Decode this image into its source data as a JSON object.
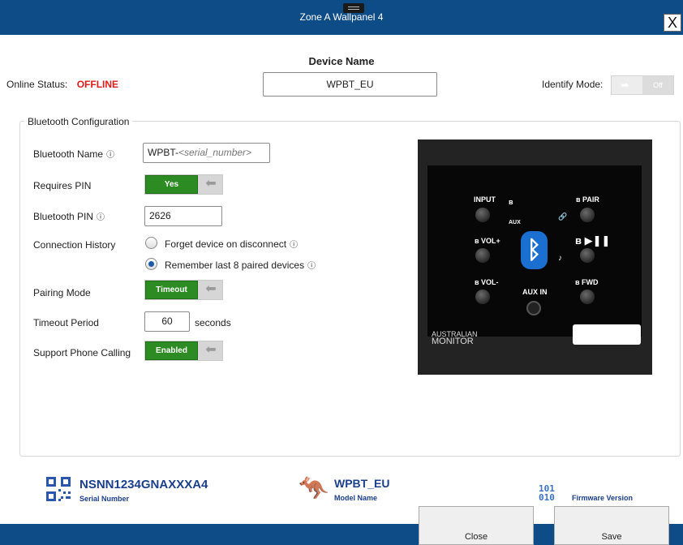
{
  "window": {
    "title": "Zone A Wallpanel 4",
    "close_label": "X"
  },
  "device": {
    "name_label": "Device Name",
    "name_value": "WPBT_EU",
    "online_label": "Online Status:",
    "online_value": "OFFLINE",
    "identify_label": "Identify Mode:",
    "identify_state": "Off"
  },
  "bluetooth": {
    "group_title": "Bluetooth Configuration",
    "name_label": "Bluetooth Name",
    "name_prefix": "WPBT-",
    "name_placeholder": "<serial_number>",
    "requires_pin_label": "Requires PIN",
    "requires_pin_value": "Yes",
    "pin_label": "Bluetooth PIN",
    "pin_value": "2626",
    "history_label": "Connection History",
    "history_options": [
      "Forget device on disconnect",
      "Remember last 8 paired devices"
    ],
    "history_selected_index": 1,
    "pairing_label": "Pairing Mode",
    "pairing_value": "Timeout",
    "timeout_label": "Timeout Period",
    "timeout_value": "60",
    "timeout_unit": "seconds",
    "phone_label": "Support Phone Calling",
    "phone_value": "Enabled"
  },
  "panel_image": {
    "labels": [
      "INPUT",
      "AUX",
      "PAIR",
      "VOL+",
      "VOL-",
      "FWD",
      "AUX IN"
    ],
    "brand_line1": "AUSTRALIAN",
    "brand_line2": "MONITOR"
  },
  "footer": {
    "serial_value": "NSNN1234GNAXXXA4",
    "serial_label": "Serial Number",
    "model_value": "WPBT_EU",
    "model_label": "Model Name",
    "firmware_label": "Firmware Version",
    "close_button": "Close",
    "save_button": "Save"
  },
  "colors": {
    "titlebar": "#0d4c86",
    "offline": "#e01b1b",
    "toggle_on": "#2c8b22",
    "footer_text": "#1b3f8a"
  },
  "icons": [
    "info-icon",
    "qr-code-icon",
    "kangaroo-icon",
    "binary-icon",
    "bluetooth-icon",
    "arrow-left-icon"
  ]
}
